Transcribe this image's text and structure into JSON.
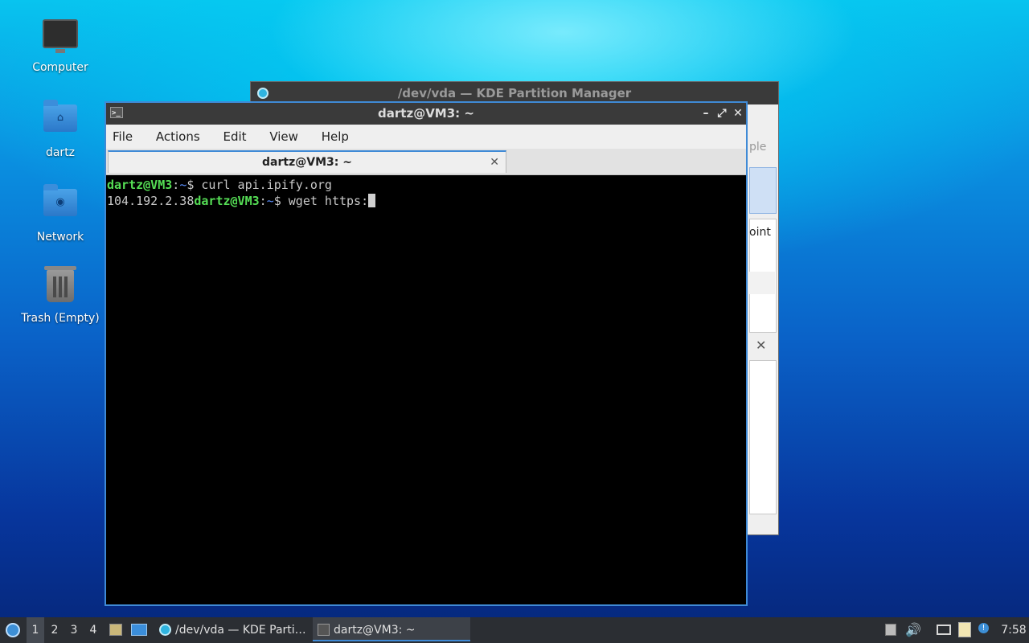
{
  "desktop": {
    "icons": [
      {
        "label": "Computer"
      },
      {
        "label": "dartz"
      },
      {
        "label": "Network"
      },
      {
        "label": "Trash (Empty)"
      }
    ]
  },
  "kde_window": {
    "title": "/dev/vda — KDE Partition Manager",
    "fragment_ple": "ple",
    "fragment_point": "oint",
    "close_glyph": "✕"
  },
  "terminal": {
    "title": "dartz@VM3: ~",
    "buttons": {
      "minimize": "–",
      "maximize": "⤢",
      "close": "✕"
    },
    "menu": [
      "File",
      "Actions",
      "Edit",
      "View",
      "Help"
    ],
    "tab": {
      "label": "dartz@VM3: ~",
      "close_glyph": "✕"
    },
    "lines": [
      {
        "user_host": "dartz@VM3",
        "sep": ":",
        "path": "~",
        "prompt": "$ ",
        "command": "curl api.ipify.org",
        "prefix_output": ""
      },
      {
        "prefix_output": "104.192.2.38",
        "user_host": "dartz@VM3",
        "sep": ":",
        "path": "~",
        "prompt": "$ ",
        "command": "wget https:"
      }
    ]
  },
  "taskbar": {
    "workspaces": [
      "1",
      "2",
      "3",
      "4"
    ],
    "active_workspace": "1",
    "tasks": [
      {
        "label": "/dev/vda — KDE Parti…",
        "icon": "partition-manager-icon"
      },
      {
        "label": "dartz@VM3: ~",
        "icon": "terminal-icon"
      }
    ],
    "clock": "7:58"
  },
  "colors": {
    "accent": "#3f8ad6",
    "prompt_user": "#55dd55",
    "prompt_path": "#5b8fff"
  }
}
